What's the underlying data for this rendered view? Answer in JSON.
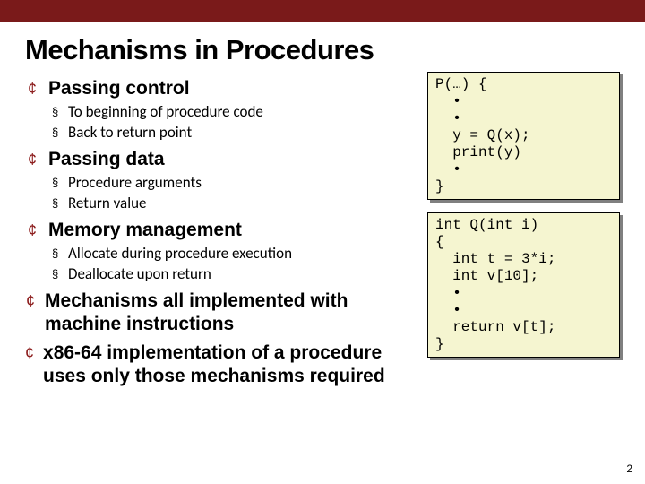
{
  "title": "Mechanisms in Procedures",
  "sections": [
    {
      "heading": "Passing control",
      "items": [
        "To beginning of procedure code",
        "Back to return point"
      ]
    },
    {
      "heading": "Passing data",
      "items": [
        "Procedure arguments",
        "Return value"
      ]
    },
    {
      "heading": "Memory management",
      "items": [
        "Allocate during procedure execution",
        "Deallocate upon return"
      ]
    },
    {
      "heading": "Mechanisms all implemented with machine instructions",
      "items": []
    },
    {
      "heading": "x86-64 implementation of a procedure uses only those mechanisms required",
      "items": []
    }
  ],
  "code1": "P(…) {\n  •\n  •\n  y = Q(x);\n  print(y)\n  •\n}",
  "code2": "int Q(int i)\n{\n  int t = 3*i;\n  int v[10];\n  •\n  •\n  return v[t];\n}",
  "page_number": "2"
}
